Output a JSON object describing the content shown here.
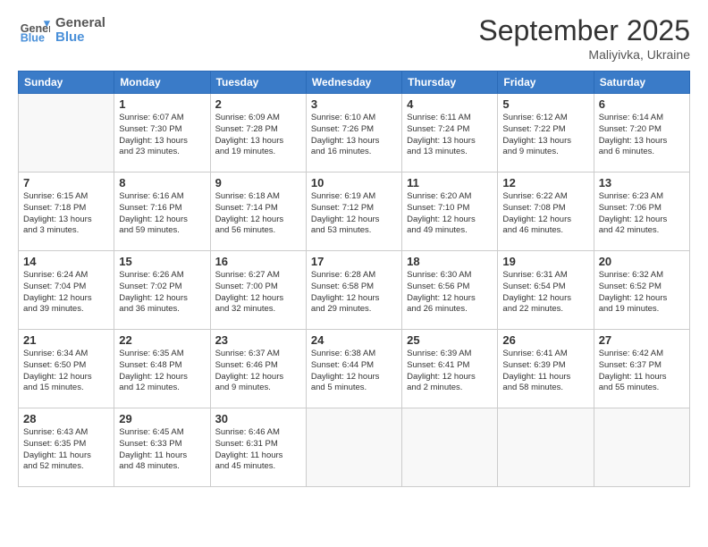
{
  "logo": {
    "line1": "General",
    "line2": "Blue"
  },
  "title": "September 2025",
  "location": "Maliyivka, Ukraine",
  "days_of_week": [
    "Sunday",
    "Monday",
    "Tuesday",
    "Wednesday",
    "Thursday",
    "Friday",
    "Saturday"
  ],
  "weeks": [
    [
      {
        "day": "",
        "info": ""
      },
      {
        "day": "1",
        "info": "Sunrise: 6:07 AM\nSunset: 7:30 PM\nDaylight: 13 hours\nand 23 minutes."
      },
      {
        "day": "2",
        "info": "Sunrise: 6:09 AM\nSunset: 7:28 PM\nDaylight: 13 hours\nand 19 minutes."
      },
      {
        "day": "3",
        "info": "Sunrise: 6:10 AM\nSunset: 7:26 PM\nDaylight: 13 hours\nand 16 minutes."
      },
      {
        "day": "4",
        "info": "Sunrise: 6:11 AM\nSunset: 7:24 PM\nDaylight: 13 hours\nand 13 minutes."
      },
      {
        "day": "5",
        "info": "Sunrise: 6:12 AM\nSunset: 7:22 PM\nDaylight: 13 hours\nand 9 minutes."
      },
      {
        "day": "6",
        "info": "Sunrise: 6:14 AM\nSunset: 7:20 PM\nDaylight: 13 hours\nand 6 minutes."
      }
    ],
    [
      {
        "day": "7",
        "info": "Sunrise: 6:15 AM\nSunset: 7:18 PM\nDaylight: 13 hours\nand 3 minutes."
      },
      {
        "day": "8",
        "info": "Sunrise: 6:16 AM\nSunset: 7:16 PM\nDaylight: 12 hours\nand 59 minutes."
      },
      {
        "day": "9",
        "info": "Sunrise: 6:18 AM\nSunset: 7:14 PM\nDaylight: 12 hours\nand 56 minutes."
      },
      {
        "day": "10",
        "info": "Sunrise: 6:19 AM\nSunset: 7:12 PM\nDaylight: 12 hours\nand 53 minutes."
      },
      {
        "day": "11",
        "info": "Sunrise: 6:20 AM\nSunset: 7:10 PM\nDaylight: 12 hours\nand 49 minutes."
      },
      {
        "day": "12",
        "info": "Sunrise: 6:22 AM\nSunset: 7:08 PM\nDaylight: 12 hours\nand 46 minutes."
      },
      {
        "day": "13",
        "info": "Sunrise: 6:23 AM\nSunset: 7:06 PM\nDaylight: 12 hours\nand 42 minutes."
      }
    ],
    [
      {
        "day": "14",
        "info": "Sunrise: 6:24 AM\nSunset: 7:04 PM\nDaylight: 12 hours\nand 39 minutes."
      },
      {
        "day": "15",
        "info": "Sunrise: 6:26 AM\nSunset: 7:02 PM\nDaylight: 12 hours\nand 36 minutes."
      },
      {
        "day": "16",
        "info": "Sunrise: 6:27 AM\nSunset: 7:00 PM\nDaylight: 12 hours\nand 32 minutes."
      },
      {
        "day": "17",
        "info": "Sunrise: 6:28 AM\nSunset: 6:58 PM\nDaylight: 12 hours\nand 29 minutes."
      },
      {
        "day": "18",
        "info": "Sunrise: 6:30 AM\nSunset: 6:56 PM\nDaylight: 12 hours\nand 26 minutes."
      },
      {
        "day": "19",
        "info": "Sunrise: 6:31 AM\nSunset: 6:54 PM\nDaylight: 12 hours\nand 22 minutes."
      },
      {
        "day": "20",
        "info": "Sunrise: 6:32 AM\nSunset: 6:52 PM\nDaylight: 12 hours\nand 19 minutes."
      }
    ],
    [
      {
        "day": "21",
        "info": "Sunrise: 6:34 AM\nSunset: 6:50 PM\nDaylight: 12 hours\nand 15 minutes."
      },
      {
        "day": "22",
        "info": "Sunrise: 6:35 AM\nSunset: 6:48 PM\nDaylight: 12 hours\nand 12 minutes."
      },
      {
        "day": "23",
        "info": "Sunrise: 6:37 AM\nSunset: 6:46 PM\nDaylight: 12 hours\nand 9 minutes."
      },
      {
        "day": "24",
        "info": "Sunrise: 6:38 AM\nSunset: 6:44 PM\nDaylight: 12 hours\nand 5 minutes."
      },
      {
        "day": "25",
        "info": "Sunrise: 6:39 AM\nSunset: 6:41 PM\nDaylight: 12 hours\nand 2 minutes."
      },
      {
        "day": "26",
        "info": "Sunrise: 6:41 AM\nSunset: 6:39 PM\nDaylight: 11 hours\nand 58 minutes."
      },
      {
        "day": "27",
        "info": "Sunrise: 6:42 AM\nSunset: 6:37 PM\nDaylight: 11 hours\nand 55 minutes."
      }
    ],
    [
      {
        "day": "28",
        "info": "Sunrise: 6:43 AM\nSunset: 6:35 PM\nDaylight: 11 hours\nand 52 minutes."
      },
      {
        "day": "29",
        "info": "Sunrise: 6:45 AM\nSunset: 6:33 PM\nDaylight: 11 hours\nand 48 minutes."
      },
      {
        "day": "30",
        "info": "Sunrise: 6:46 AM\nSunset: 6:31 PM\nDaylight: 11 hours\nand 45 minutes."
      },
      {
        "day": "",
        "info": ""
      },
      {
        "day": "",
        "info": ""
      },
      {
        "day": "",
        "info": ""
      },
      {
        "day": "",
        "info": ""
      }
    ]
  ]
}
